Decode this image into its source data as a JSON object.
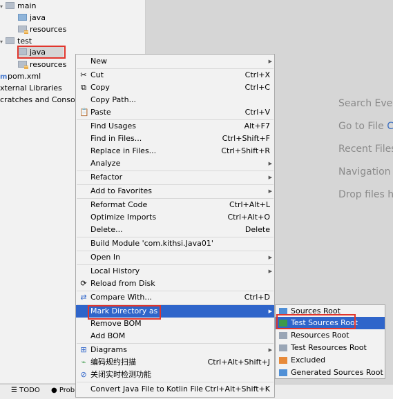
{
  "project_tree": {
    "nodes": [
      {
        "label": "main",
        "icon": "folder-icon"
      },
      {
        "label": "java",
        "icon": "source-folder-icon"
      },
      {
        "label": "resources",
        "icon": "resources-folder-icon"
      },
      {
        "label": "test",
        "icon": "folder-icon"
      },
      {
        "label": "java",
        "icon": "folder-icon"
      },
      {
        "label": "resources",
        "icon": "resources-folder-icon"
      },
      {
        "label": "pom.xml",
        "icon": "maven-icon"
      },
      {
        "label": "xternal Libraries",
        "icon": "library-icon"
      },
      {
        "label": "cratches and Consoles",
        "icon": "scratches-icon"
      }
    ]
  },
  "editor_hints": [
    {
      "label": "Search Ever"
    },
    {
      "label": "Go to File ",
      "key": "C"
    },
    {
      "label": "Recent Files"
    },
    {
      "label": "Navigation"
    },
    {
      "label": "Drop files h"
    }
  ],
  "bottom_bar": {
    "todo_label": "TODO",
    "problems_label": "Probl"
  },
  "context_menu": {
    "items": [
      {
        "label": "New",
        "shortcut": "",
        "submenu": true,
        "icon": ""
      },
      {
        "label": "Cut",
        "shortcut": "Ctrl+X",
        "icon": "scissors-icon"
      },
      {
        "label": "Copy",
        "shortcut": "Ctrl+C",
        "icon": "copy-icon"
      },
      {
        "label": "Copy Path...",
        "shortcut": ""
      },
      {
        "label": "Paste",
        "shortcut": "Ctrl+V",
        "icon": "paste-icon"
      },
      {
        "label": "Find Usages",
        "shortcut": "Alt+F7"
      },
      {
        "label": "Find in Files...",
        "shortcut": "Ctrl+Shift+F"
      },
      {
        "label": "Replace in Files...",
        "shortcut": "Ctrl+Shift+R"
      },
      {
        "label": "Analyze",
        "shortcut": "",
        "submenu": true
      },
      {
        "label": "Refactor",
        "shortcut": "",
        "submenu": true
      },
      {
        "label": "Add to Favorites",
        "shortcut": "",
        "submenu": true
      },
      {
        "label": "Reformat Code",
        "shortcut": "Ctrl+Alt+L"
      },
      {
        "label": "Optimize Imports",
        "shortcut": "Ctrl+Alt+O"
      },
      {
        "label": "Delete...",
        "shortcut": "Delete"
      },
      {
        "label": "Build Module 'com.kithsi.Java01'",
        "shortcut": ""
      },
      {
        "label": "Open In",
        "shortcut": "",
        "submenu": true
      },
      {
        "label": "Local History",
        "shortcut": "",
        "submenu": true
      },
      {
        "label": "Reload from Disk",
        "shortcut": "",
        "icon": "reload-icon"
      },
      {
        "label": "Compare With...",
        "shortcut": "Ctrl+D",
        "icon": "compare-icon"
      },
      {
        "label": "Mark Directory as",
        "shortcut": "",
        "submenu": true,
        "highlighted": true
      },
      {
        "label": "Remove BOM",
        "shortcut": ""
      },
      {
        "label": "Add BOM",
        "shortcut": ""
      },
      {
        "label": "Diagrams",
        "shortcut": "",
        "submenu": true,
        "icon": "diagram-icon"
      },
      {
        "label": "编码规约扫描",
        "shortcut": "Ctrl+Alt+Shift+J",
        "icon": "scan-icon"
      },
      {
        "label": "关闭实时检测功能",
        "shortcut": "",
        "icon": "disable-icon"
      },
      {
        "label": "Convert Java File to Kotlin File",
        "shortcut": "Ctrl+Alt+Shift+K"
      }
    ]
  },
  "mark_directory_submenu": {
    "items": [
      {
        "label": "Sources Root",
        "color": "#4f8fd6"
      },
      {
        "label": "Test Sources Root",
        "color": "#3d9a4b",
        "highlighted": true
      },
      {
        "label": "Resources Root",
        "color": "#9aa6b6"
      },
      {
        "label": "Test Resources Root",
        "color": "#9aa6b6"
      },
      {
        "label": "Excluded",
        "color": "#e78a3a"
      },
      {
        "label": "Generated Sources Root",
        "color": "#4f8fd6"
      }
    ]
  },
  "colors": {
    "highlight": "#2f65ca",
    "annotation_box": "#e1352c"
  }
}
